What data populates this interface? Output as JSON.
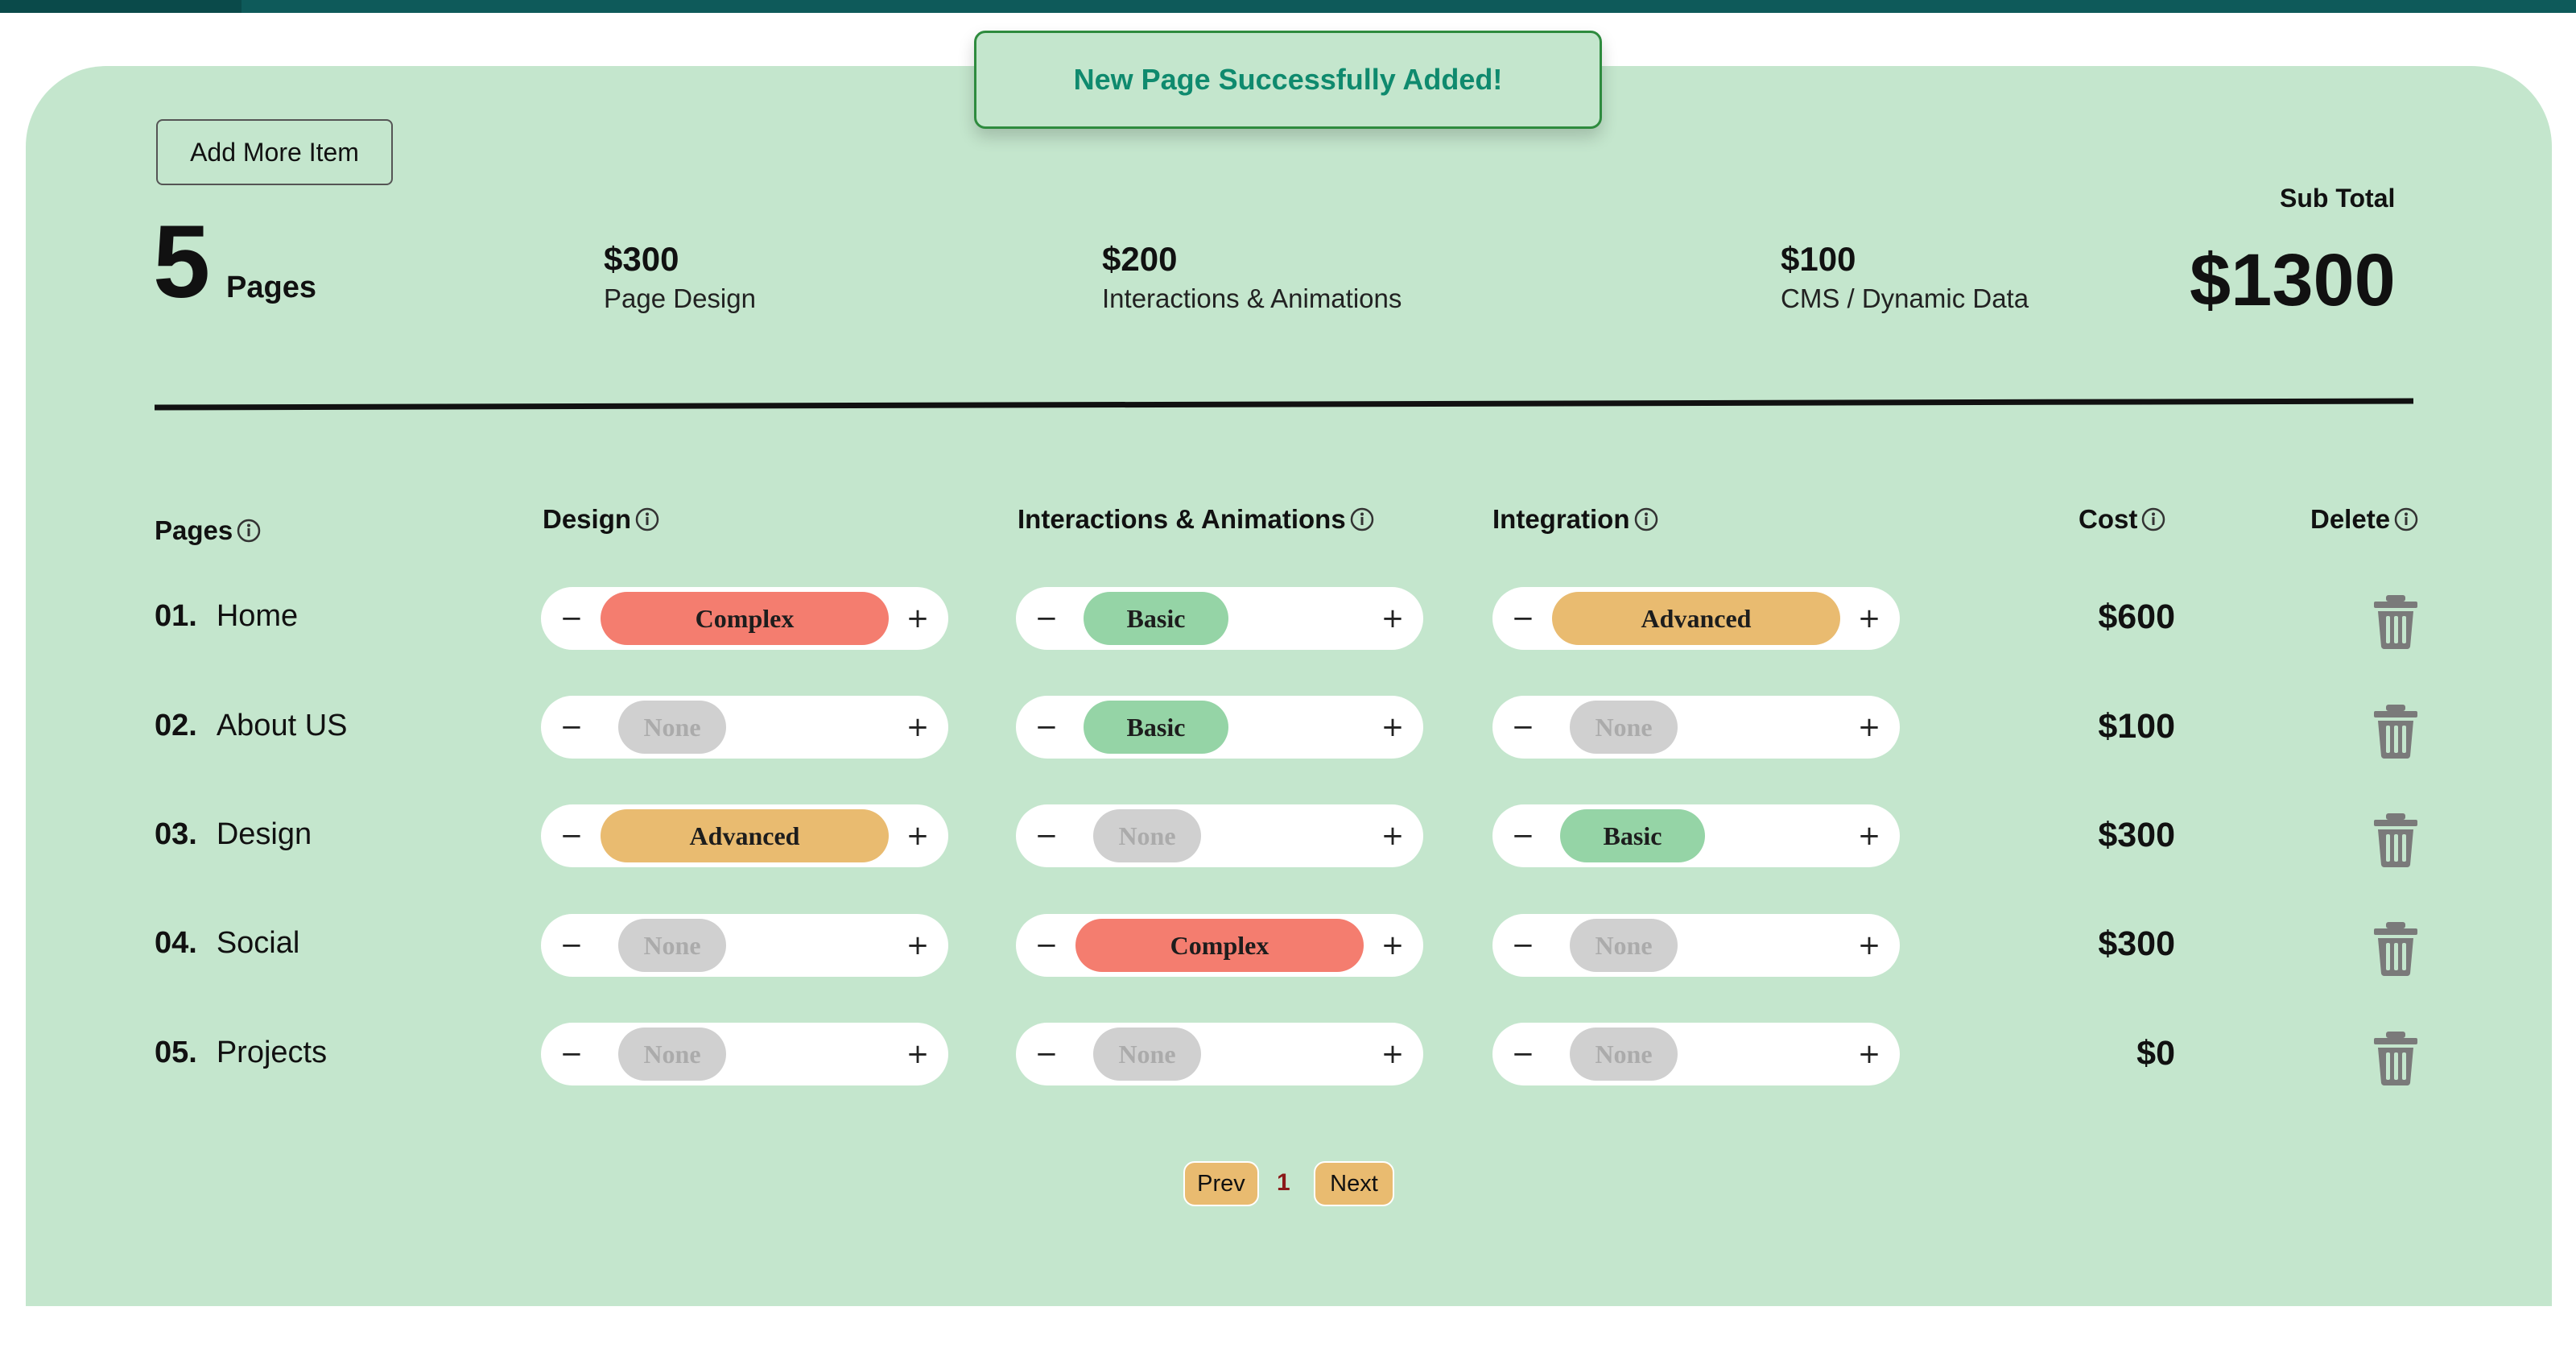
{
  "toast": {
    "message": "New Page Successfully Added!"
  },
  "toolbar": {
    "add_label": "Add More Item"
  },
  "summary": {
    "pages_count": "5",
    "pages_label": "Pages",
    "stats": [
      {
        "price": "$300",
        "label": "Page Design"
      },
      {
        "price": "$200",
        "label": "Interactions & Animations"
      },
      {
        "price": "$100",
        "label": "CMS / Dynamic Data"
      }
    ],
    "subtotal_label": "Sub Total",
    "subtotal_value": "$1300"
  },
  "table": {
    "headers": {
      "pages": "Pages",
      "design": "Design",
      "interactions": "Interactions & Animations",
      "integration": "Integration",
      "cost": "Cost",
      "delete": "Delete"
    },
    "rows": [
      {
        "num": "01.",
        "name": "Home",
        "design": "Complex",
        "interactions": "Basic",
        "integration": "Advanced",
        "cost": "$600"
      },
      {
        "num": "02.",
        "name": "About US",
        "design": "None",
        "interactions": "Basic",
        "integration": "None",
        "cost": "$100"
      },
      {
        "num": "03.",
        "name": "Design",
        "design": "Advanced",
        "interactions": "None",
        "integration": "Basic",
        "cost": "$300"
      },
      {
        "num": "04.",
        "name": "Social",
        "design": "None",
        "interactions": "Complex",
        "integration": "None",
        "cost": "$300"
      },
      {
        "num": "05.",
        "name": "Projects",
        "design": "None",
        "interactions": "None",
        "integration": "None",
        "cost": "$0"
      }
    ],
    "icons": {
      "minus": "minus-icon",
      "plus": "plus-icon",
      "info": "info-icon",
      "delete": "trash-icon"
    }
  },
  "pagination": {
    "prev_label": "Prev",
    "current_page": "1",
    "next_label": "Next"
  },
  "colors": {
    "panel_bg": "#c4e6cd",
    "top_bar": "#0e5a5a",
    "complex": "#f47d6f",
    "advanced": "#e9bb70",
    "basic": "#95d4a6",
    "none": "#d0d0d0",
    "toast_text": "#0f8a6e"
  }
}
